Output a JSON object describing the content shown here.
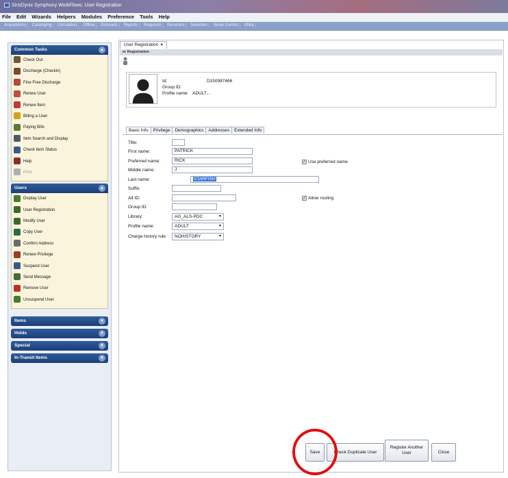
{
  "window": {
    "title": "SirsiDynix Symphony WorkFlows: User Registration"
  },
  "menubar": [
    "File",
    "Edit",
    "Wizards",
    "Helpers",
    "Modules",
    "Preference",
    "Tools",
    "Help"
  ],
  "modules": [
    "Acquisitions",
    "Cataloging",
    "Circulation",
    "Offline",
    "Outreach",
    "Reports",
    "Requests",
    "Reserves",
    "Selection",
    "Serial Control",
    "Utility"
  ],
  "sidebar": {
    "common_title": "Common Tasks",
    "common_tasks": [
      {
        "label": "Check Out",
        "color": "#6b5a3a"
      },
      {
        "label": "Discharge (Checkin)",
        "color": "#7a4a2a"
      },
      {
        "label": "Fine Free Discharge",
        "color": "#b04a3a"
      },
      {
        "label": "Renew User",
        "color": "#c0503a"
      },
      {
        "label": "Renew Item",
        "color": "#c03a3a"
      },
      {
        "label": "Billing a User",
        "color": "#d8a020"
      },
      {
        "label": "Paying Bills",
        "color": "#5a7a3a"
      },
      {
        "label": "Item Search and Display",
        "color": "#4a5a6a"
      },
      {
        "label": "Check Item Status",
        "color": "#3a5a8a"
      },
      {
        "label": "Help",
        "color": "#8a2a2a"
      },
      {
        "label": "Print",
        "color": "#b0b0b0",
        "disabled": true
      }
    ],
    "users_title": "Users",
    "users_tasks": [
      {
        "label": "Display User",
        "color": "#4a7a2a"
      },
      {
        "label": "User Registration",
        "color": "#3a6a2a"
      },
      {
        "label": "Modify User",
        "color": "#3a6a2a"
      },
      {
        "label": "Copy User",
        "color": "#2a6a4a"
      },
      {
        "label": "Confirm Address",
        "color": "#6a6a6a"
      },
      {
        "label": "Renew Privilege",
        "color": "#a03a2a"
      },
      {
        "label": "Suspend User",
        "color": "#3a5a8a"
      },
      {
        "label": "Send Message",
        "color": "#4a6a3a"
      },
      {
        "label": "Remove User",
        "color": "#c03020"
      },
      {
        "label": "Unsuspend User",
        "color": "#4a7a2a"
      }
    ],
    "collapsed": [
      "Items",
      "Holds",
      "Special",
      "In-Transit Items"
    ]
  },
  "content": {
    "tab_label": "User Registration",
    "subheader": "er Registration",
    "header": {
      "id_label": "Id:",
      "id_value": "D150987466",
      "group_label": "Group ID:",
      "group_value": "",
      "profile_label": "Profile name:",
      "profile_value": "ADULT..."
    },
    "tabs": [
      "Basic Info",
      "Privilege",
      "Demographics",
      "Addresses",
      "Extended Info"
    ],
    "form": {
      "title_label": "Title:",
      "title_value": "",
      "first_label": "First name:",
      "first_value": "PATRICK",
      "preferred_label": "Preferred name:",
      "preferred_value": "RICK",
      "middle_label": "Middle name:",
      "middle_value": "J",
      "last_label": "Last name:",
      "last_value": "STARFISH",
      "suffix_label": "Suffix:",
      "suffix_value": "",
      "altid_label": "Alt ID:",
      "altid_value": "",
      "groupid_label": "Group ID:",
      "groupid_value": "",
      "library_label": "Library:",
      "library_value": "AG_ALS-PDC",
      "profile_label": "Profile name:",
      "profile_value": "ADULT",
      "charge_label": "Charge history rule:",
      "charge_value": "NOHISTORY",
      "use_preferred_label": "Use preferred name",
      "allow_routing_label": "Allow routing"
    },
    "buttons": {
      "save": "Save",
      "check_dup": "Check Duplicate User",
      "register_another": "Register Another User",
      "close": "Close"
    }
  }
}
